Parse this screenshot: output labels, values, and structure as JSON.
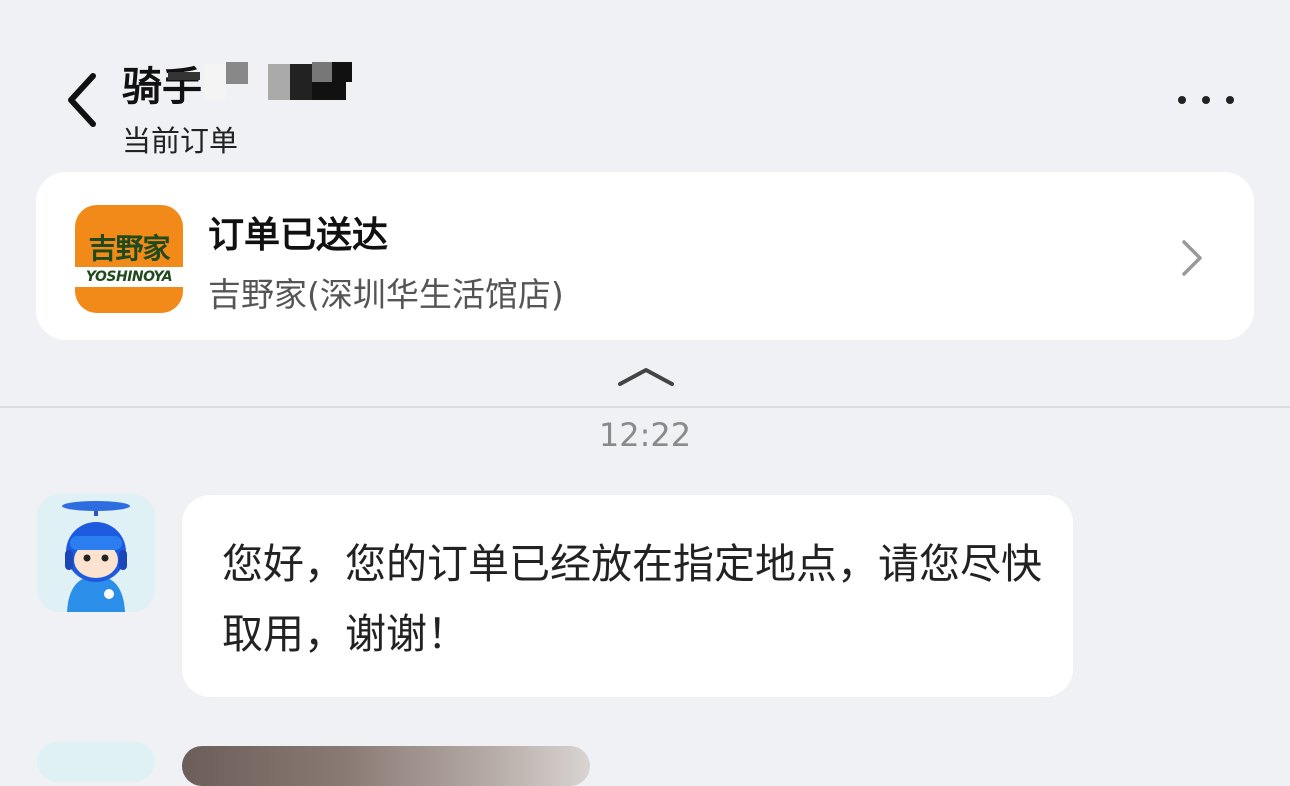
{
  "header": {
    "title": "骑手",
    "subtitle": "当前订单"
  },
  "order_card": {
    "status": "订单已送达",
    "store": "吉野家(深圳华生活馆店)",
    "logo_cn": "吉野家",
    "logo_en": "YOSHINOYA"
  },
  "chat": {
    "timestamp": "12:22",
    "messages": [
      {
        "text": "您好，您的订单已经放在指定地点，请您尽快取用，谢谢！"
      }
    ]
  },
  "colors": {
    "background": "#f0f1f5",
    "card": "#ffffff",
    "logo_orange": "#f28a1a",
    "logo_green": "#1f4a1c",
    "avatar_bg": "#dff1f5"
  },
  "icons": [
    "back-chevron-icon",
    "more-dots-icon",
    "chevron-right-icon",
    "collapse-chevron-icon"
  ]
}
